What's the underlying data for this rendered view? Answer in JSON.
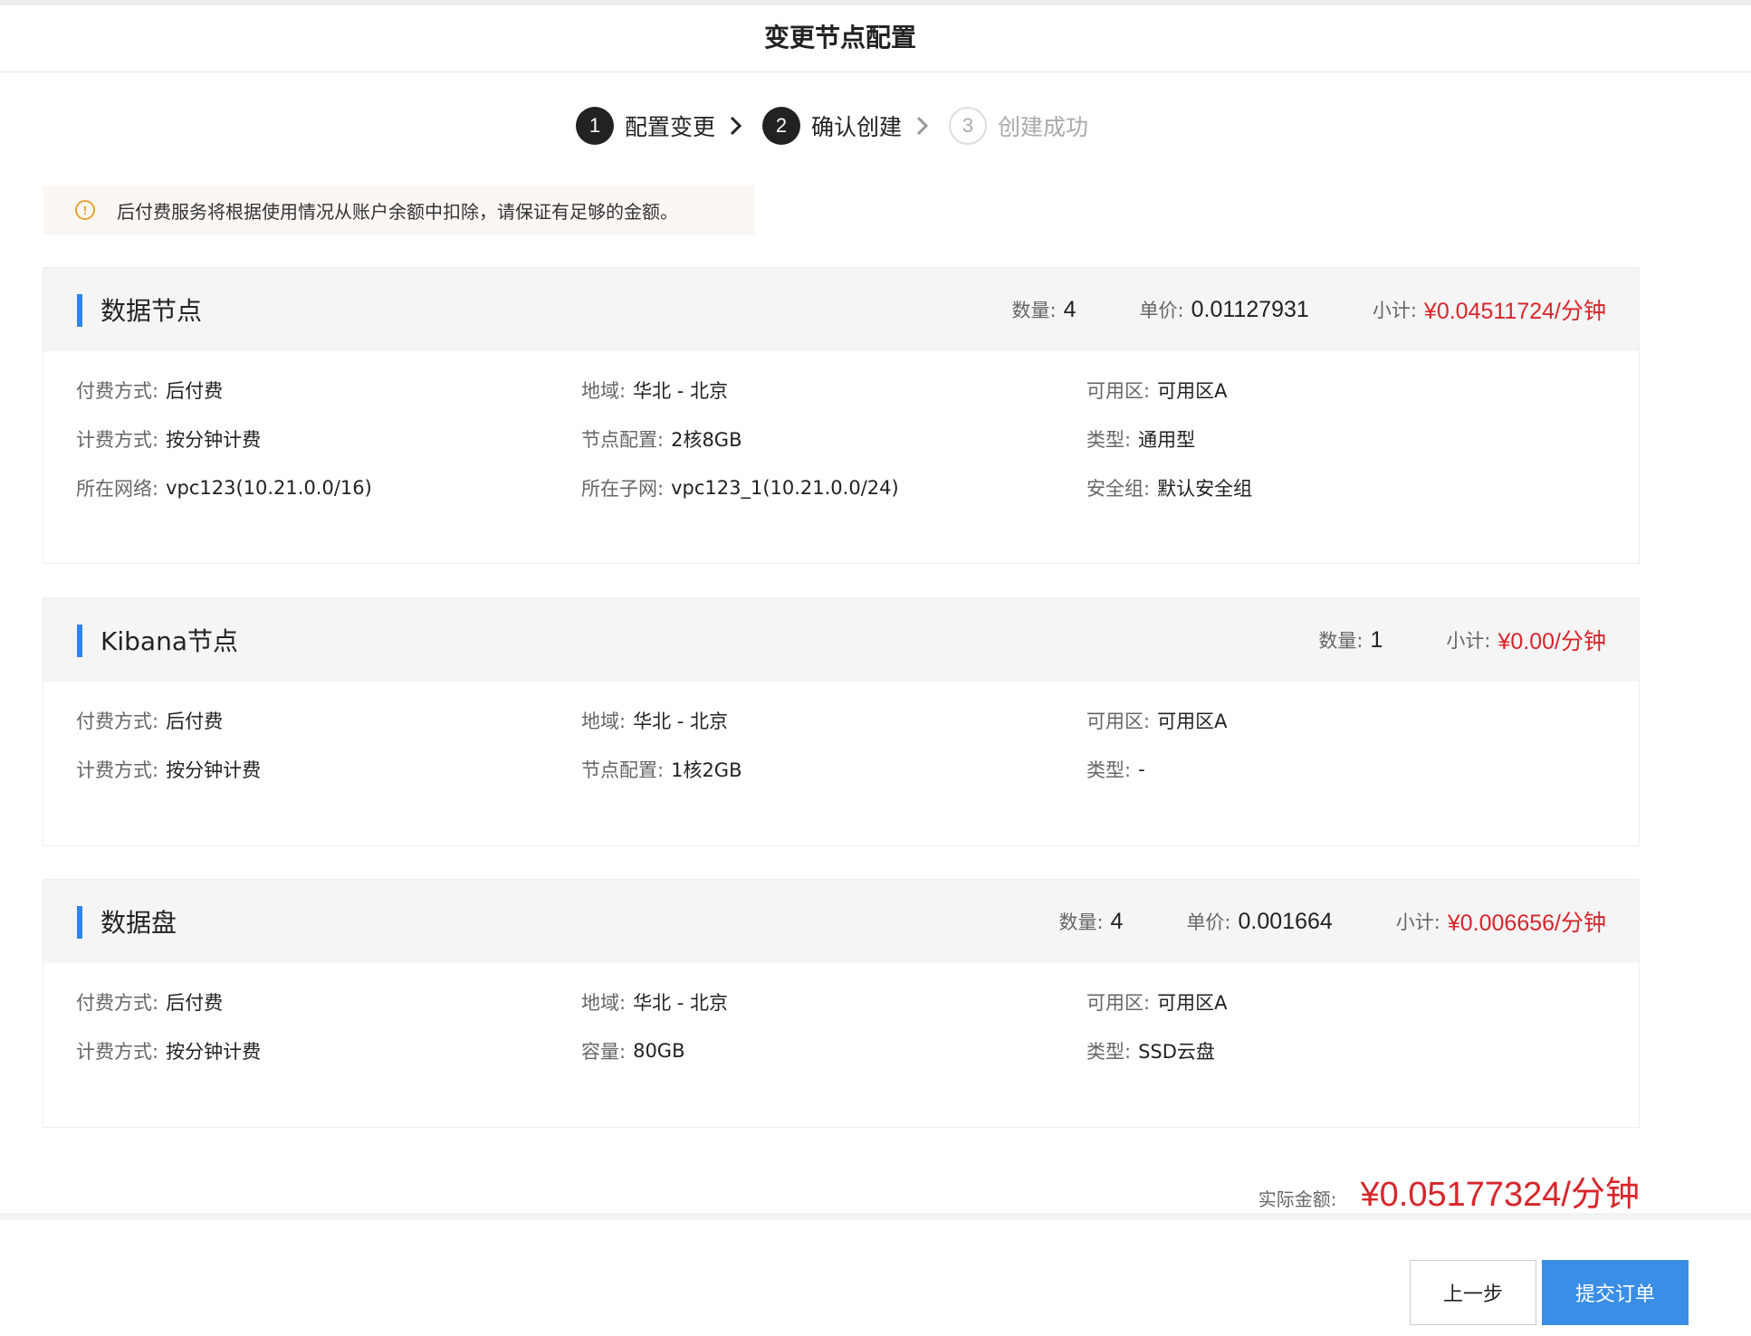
{
  "title": "变更节点配置",
  "steps": [
    {
      "num": "1",
      "label": "配置变更",
      "state": "done"
    },
    {
      "num": "2",
      "label": "确认创建",
      "state": "current"
    },
    {
      "num": "3",
      "label": "创建成功",
      "state": "todo"
    }
  ],
  "notice": {
    "icon": "warning-circle-icon",
    "text": "后付费服务将根据使用情况从账户余额中扣除，请保证有足够的金额。"
  },
  "sections": [
    {
      "title": "数据节点",
      "metrics": {
        "count_label": "数量:",
        "count": "4",
        "unit_label": "单价:",
        "unit_price": "0.01127931",
        "subtotal_label": "小计:",
        "subtotal": "¥0.04511724/分钟"
      },
      "fields": [
        {
          "k": "付费方式:",
          "v": "后付费"
        },
        {
          "k": "地域:",
          "v": "华北 - 北京"
        },
        {
          "k": "可用区:",
          "v": "可用区A"
        },
        {
          "k": "计费方式:",
          "v": "按分钟计费"
        },
        {
          "k": "节点配置:",
          "v": "2核8GB"
        },
        {
          "k": "类型:",
          "v": "通用型"
        },
        {
          "k": "所在网络:",
          "v": "vpc123(10.21.0.0/16)"
        },
        {
          "k": "所在子网:",
          "v": "vpc123_1(10.21.0.0/24)"
        },
        {
          "k": "安全组:",
          "v": "默认安全组"
        }
      ]
    },
    {
      "title": "Kibana节点",
      "metrics": {
        "count_label": "数量:",
        "count": "1",
        "subtotal_label": "小计:",
        "subtotal": "¥0.00/分钟"
      },
      "fields": [
        {
          "k": "付费方式:",
          "v": "后付费"
        },
        {
          "k": "地域:",
          "v": "华北 - 北京"
        },
        {
          "k": "可用区:",
          "v": "可用区A"
        },
        {
          "k": "计费方式:",
          "v": "按分钟计费"
        },
        {
          "k": "节点配置:",
          "v": "1核2GB"
        },
        {
          "k": "类型:",
          "v": "-"
        }
      ]
    },
    {
      "title": "数据盘",
      "metrics": {
        "count_label": "数量:",
        "count": "4",
        "unit_label": "单价:",
        "unit_price": "0.001664",
        "subtotal_label": "小计:",
        "subtotal": "¥0.006656/分钟"
      },
      "fields": [
        {
          "k": "付费方式:",
          "v": "后付费"
        },
        {
          "k": "地域:",
          "v": "华北 - 北京"
        },
        {
          "k": "可用区:",
          "v": "可用区A"
        },
        {
          "k": "计费方式:",
          "v": "按分钟计费"
        },
        {
          "k": "容量:",
          "v": "80GB"
        },
        {
          "k": "类型:",
          "v": "SSD云盘"
        }
      ]
    }
  ],
  "total": {
    "label": "实际金额:",
    "value": "¥0.05177324/分钟"
  },
  "buttons": {
    "prev": "上一步",
    "submit": "提交订单"
  },
  "colors": {
    "accent": "#3a8ee6",
    "price": "#d7262b",
    "section_bar": "#2f86e8",
    "warning": "#e8a33a"
  }
}
